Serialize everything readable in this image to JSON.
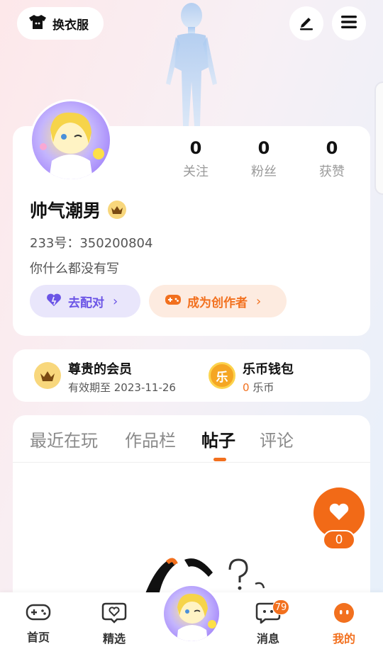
{
  "header": {
    "dress_up_label": "换衣服",
    "icons": [
      "tshirt-icon",
      "edit-icon",
      "menu-icon"
    ]
  },
  "profile": {
    "stats": [
      {
        "value": "0",
        "label": "关注"
      },
      {
        "value": "0",
        "label": "粉丝"
      },
      {
        "value": "0",
        "label": "获赞"
      }
    ],
    "name": "帅气潮男",
    "uid": "233号：350200804",
    "bio": "你什么都没有写",
    "match_button": "去配对",
    "creator_button": "成为创作者"
  },
  "membership": {
    "vip_title": "尊贵的会员",
    "vip_validity": "有效期至 2023-11-26",
    "wallet_title": "乐币钱包",
    "coin_glyph": "乐",
    "wallet_amount": "0",
    "wallet_unit": "乐币"
  },
  "tabs": [
    {
      "label": "最近在玩",
      "active": false
    },
    {
      "label": "作品栏",
      "active": false
    },
    {
      "label": "帖子",
      "active": true
    },
    {
      "label": "评论",
      "active": false
    }
  ],
  "like": {
    "count": "0"
  },
  "bottom_nav": {
    "items": [
      {
        "label": "首页",
        "icon": "gamepad-icon"
      },
      {
        "label": "精选",
        "icon": "heart-chat-icon"
      },
      {
        "label": "消息",
        "icon": "chat-icon"
      },
      {
        "label": "我的",
        "icon": "face-icon"
      }
    ],
    "message_badge": "79"
  },
  "colors": {
    "accent": "#f2701e",
    "purple": "#6b54e6",
    "gold": "#f8d77c"
  }
}
